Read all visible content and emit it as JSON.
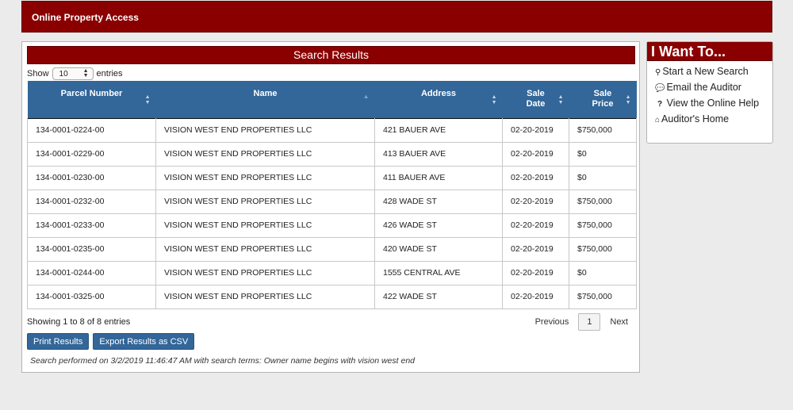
{
  "header": {
    "title": "Online Property Access"
  },
  "results": {
    "title": "Search Results",
    "show_label": "Show",
    "entries_value": "10",
    "entries_label": "entries",
    "columns": [
      "Parcel Number",
      "Name",
      "Address",
      "Sale Date",
      "Sale Price"
    ],
    "rows": [
      [
        "134-0001-0224-00",
        "VISION WEST END PROPERTIES LLC",
        "421 BAUER AVE",
        "02-20-2019",
        "$750,000"
      ],
      [
        "134-0001-0229-00",
        "VISION WEST END PROPERTIES LLC",
        "413 BAUER AVE",
        "02-20-2019",
        "$0"
      ],
      [
        "134-0001-0230-00",
        "VISION WEST END PROPERTIES LLC",
        "411 BAUER AVE",
        "02-20-2019",
        "$0"
      ],
      [
        "134-0001-0232-00",
        "VISION WEST END PROPERTIES LLC",
        "428 WADE ST",
        "02-20-2019",
        "$750,000"
      ],
      [
        "134-0001-0233-00",
        "VISION WEST END PROPERTIES LLC",
        "426 WADE ST",
        "02-20-2019",
        "$750,000"
      ],
      [
        "134-0001-0235-00",
        "VISION WEST END PROPERTIES LLC",
        "420 WADE ST",
        "02-20-2019",
        "$750,000"
      ],
      [
        "134-0001-0244-00",
        "VISION WEST END PROPERTIES LLC",
        "1555 CENTRAL AVE",
        "02-20-2019",
        "$0"
      ],
      [
        "134-0001-0325-00",
        "VISION WEST END PROPERTIES LLC",
        "422 WADE ST",
        "02-20-2019",
        "$750,000"
      ]
    ],
    "info": "Showing 1 to 8 of 8 entries",
    "pager": {
      "previous": "Previous",
      "page": "1",
      "next": "Next"
    },
    "buttons": {
      "print": "Print Results",
      "export": "Export Results as CSV"
    },
    "search_note": "Search performed on 3/2/2019 11:46:47 AM with search terms: Owner name begins with vision west end"
  },
  "sidebar": {
    "title": "I Want To...",
    "items": [
      {
        "label": "Start a New Search",
        "icon": "search-icon"
      },
      {
        "label": "Email the Auditor",
        "icon": "chat-icon"
      },
      {
        "label": "View the Online Help",
        "icon": "question-icon"
      },
      {
        "label": "Auditor's Home",
        "icon": "home-icon"
      }
    ]
  },
  "colors": {
    "brand": "#8a0000",
    "table_header": "#336699",
    "button": "#336699"
  }
}
